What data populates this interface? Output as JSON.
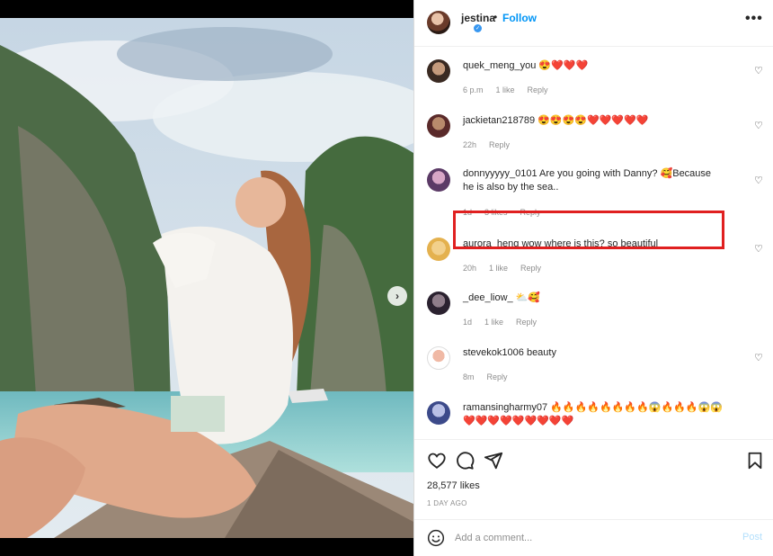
{
  "post": {
    "username": "jestina",
    "separator": "•",
    "follow_label": "Follow",
    "more_label": "•••",
    "likes_text": "28,577 likes",
    "date_text": "1 DAY AGO"
  },
  "carousel": {
    "next_label": "›",
    "slides": 5,
    "active_index": 0
  },
  "comments": [
    {
      "username": "quek_meng_you",
      "text": " 😍❤️❤️❤️",
      "time": "6 p.m",
      "likes": "1 like",
      "reply": "Reply"
    },
    {
      "username": "jackietan218789",
      "text": " 😍😍😍😍❤️❤️❤️❤️❤️",
      "time": "22h",
      "likes": "",
      "reply": "Reply"
    },
    {
      "username": "donnyyyyy_0101",
      "text": " Are you going with Danny? 🥰Because he is also by the sea..",
      "time": "1d",
      "likes": "3 likes",
      "reply": "Reply"
    },
    {
      "username": "aurora_heng",
      "text": " wow where is this? so beautiful",
      "time": "20h",
      "likes": "1 like",
      "reply": "Reply"
    },
    {
      "username": "_dee_liow_",
      "text": " ⛅🥰",
      "time": "1d",
      "likes": "1 like",
      "reply": "Reply"
    },
    {
      "username": "stevekok1006",
      "text": " beauty",
      "time": "8m",
      "likes": "",
      "reply": "Reply"
    },
    {
      "username": "ramansingharmy07",
      "text": " 🔥🔥🔥🔥🔥🔥🔥🔥😱🔥🔥🔥😱😱❤️❤️❤️❤️❤️❤️❤️❤️❤️",
      "time": "",
      "likes": "",
      "reply": ""
    }
  ],
  "composer": {
    "placeholder": "Add a comment...",
    "post_label": "Post"
  },
  "colors": {
    "accent": "#0095f6",
    "highlight_box": "#e02020",
    "muted": "#8e8e8e"
  }
}
